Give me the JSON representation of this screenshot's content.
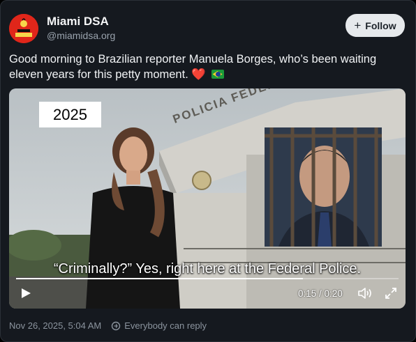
{
  "account": {
    "name": "Miami DSA",
    "handle": "@miamidsa.org",
    "avatar_icon": "rose-logo",
    "avatar_color": "#e0261a"
  },
  "follow_button": {
    "label": "Follow",
    "icon": "plus-icon"
  },
  "post": {
    "text": "Good morning to Brazilian reporter Manuela Borges, who’s been waiting eleven years for this petty moment.",
    "emoji_heart": "❤️",
    "emoji_flag": "brazil-flag"
  },
  "video": {
    "year_label": "2025",
    "caption": "“Criminally?” Yes, right here at the Federal Police.",
    "building_sign": "POLICIA FEDERAL",
    "time_display": "0:15 / 0:20",
    "progress": 0.75,
    "controls": [
      "play-icon",
      "volume-icon",
      "fullscreen-icon"
    ]
  },
  "meta": {
    "timestamp": "Nov 26, 2025, 5:04 AM",
    "reply_setting": "Everybody can reply"
  }
}
